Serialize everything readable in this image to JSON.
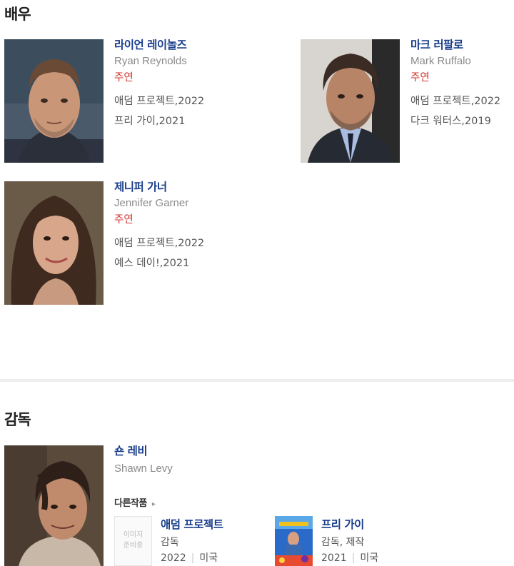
{
  "sections": {
    "actors_title": "배우",
    "director_title": "감독"
  },
  "actors": [
    {
      "name": "라이언 레이놀즈",
      "english": "Ryan Reynolds",
      "role": "주연",
      "work1": "애덤 프로젝트,2022",
      "work2": "프리 가이,2021"
    },
    {
      "name": "마크 러팔로",
      "english": "Mark Ruffalo",
      "role": "주연",
      "work1": "애덤 프로젝트,2022",
      "work2": "다크 워터스,2019"
    },
    {
      "name": "제니퍼 가너",
      "english": "Jennifer Garner",
      "role": "주연",
      "work1": "애덤 프로젝트,2022",
      "work2": "예스 데이!,2021"
    }
  ],
  "director": {
    "name": "숀 레비",
    "english": "Shawn Levy",
    "other_works_label": "다른작품",
    "films": [
      {
        "title": "애덤 프로젝트",
        "role": "감독",
        "year": "2022",
        "country": "미국",
        "placeholder": "이미지 준비중"
      },
      {
        "title": "프리 가이",
        "role": "감독, 제작",
        "year": "2021",
        "country": "미국"
      }
    ]
  }
}
